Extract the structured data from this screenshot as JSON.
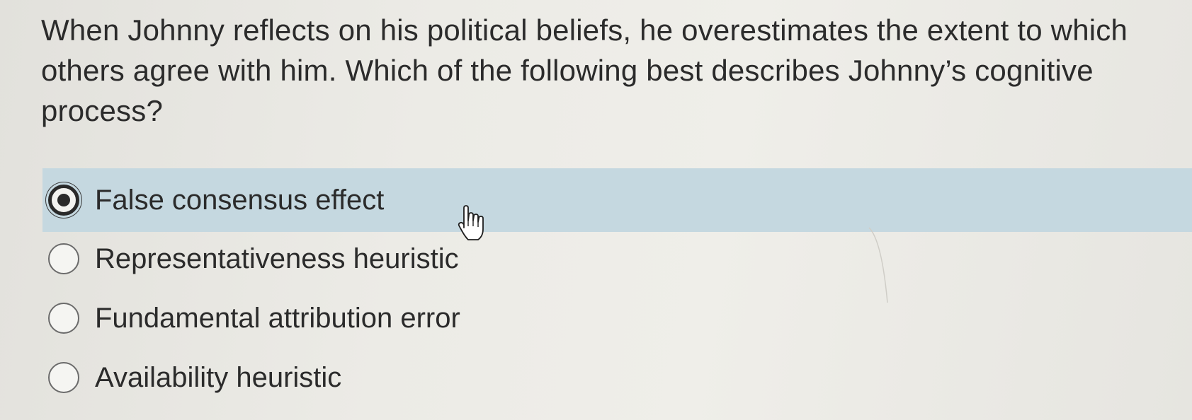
{
  "question": {
    "text": "When Johnny reflects on his political beliefs, he overestimates the extent to which others agree with him.  Which of the following best describes Johnny’s cognitive process?"
  },
  "options": [
    {
      "label": "False consensus effect",
      "selected": true
    },
    {
      "label": "Representativeness heuristic",
      "selected": false
    },
    {
      "label": "Fundamental attribution error",
      "selected": false
    },
    {
      "label": "Availability heuristic",
      "selected": false
    }
  ],
  "colors": {
    "background": "#e9e8e3",
    "selected_highlight": "#c5d8e0",
    "text": "#2b2b2b"
  },
  "cursor": {
    "icon": "hand-pointer-icon"
  }
}
